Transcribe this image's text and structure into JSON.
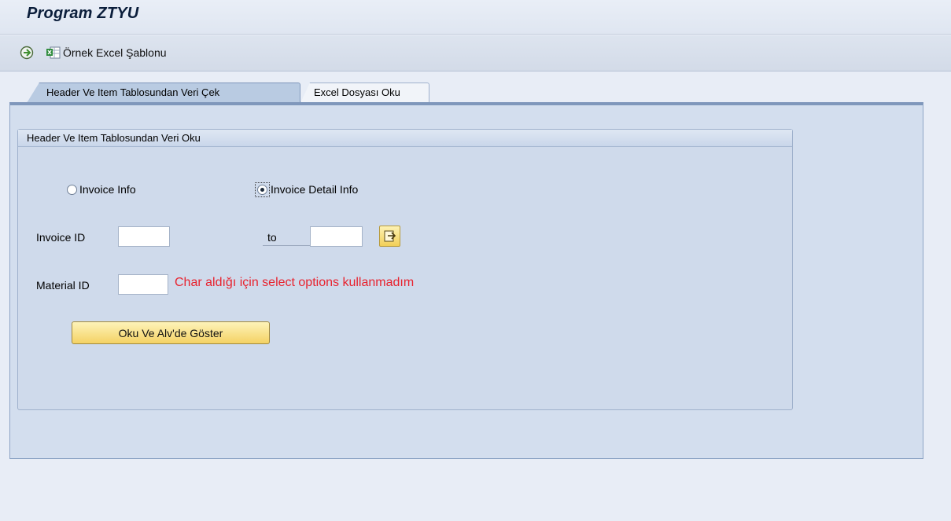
{
  "title": "Program ZTYU",
  "toolbar": {
    "execute_icon": "execute-icon",
    "excel_icon": "excel-icon",
    "template_label": "Örnek Excel Şablonu"
  },
  "tabs": [
    {
      "label": "Header Ve Item Tablosundan Veri Çek",
      "active": true
    },
    {
      "label": "Excel Dosyası Oku",
      "active": false
    }
  ],
  "group": {
    "title": "Header Ve Item Tablosundan Veri Oku",
    "radio_invoice_info": {
      "label": "Invoice Info",
      "selected": false
    },
    "radio_invoice_detail": {
      "label": "Invoice Detail Info",
      "selected": true
    },
    "invoice_id": {
      "label": "Invoice ID",
      "from": "",
      "to_label": "to",
      "to": ""
    },
    "material_id": {
      "label": "Material ID",
      "value": ""
    },
    "note": "Char aldığı için select options kullanmadım",
    "action_button": "Oku Ve Alv'de Göster"
  },
  "colors": {
    "note": "#e8232f",
    "button": "#f4d264",
    "panel": "#d3deee"
  }
}
